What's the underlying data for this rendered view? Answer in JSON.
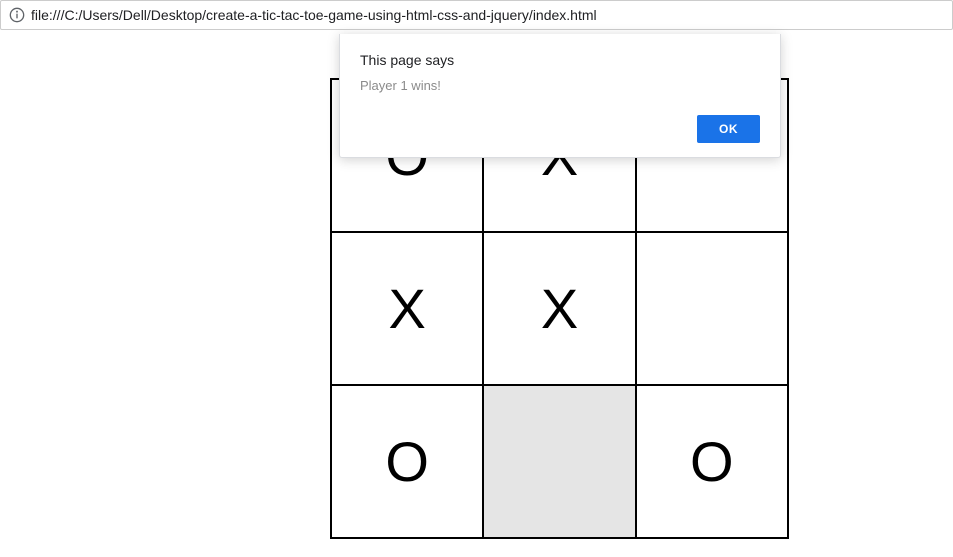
{
  "address_bar": {
    "url": "file:///C:/Users/Dell/Desktop/create-a-tic-tac-toe-game-using-html-css-and-jquery/index.html"
  },
  "dialog": {
    "title": "This page says",
    "message": "Player 1 wins!",
    "ok_label": "OK"
  },
  "board": {
    "cells": [
      [
        "O",
        "X",
        ""
      ],
      [
        "X",
        "X",
        ""
      ],
      [
        "O",
        "",
        "O"
      ]
    ],
    "highlight": [
      2,
      1
    ]
  }
}
